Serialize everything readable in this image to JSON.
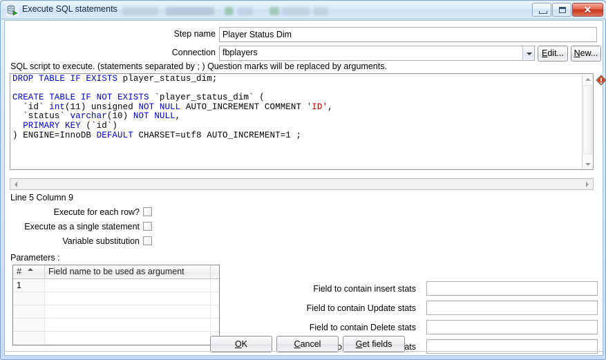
{
  "window": {
    "title": "Execute SQL statements",
    "icon": "database-execute-icon",
    "buttons": {
      "minimize": "minimize-icon",
      "maximize": "maximize-icon",
      "close": "✕"
    }
  },
  "form": {
    "step_name_label": "Step name",
    "step_name_value": "Player Status Dim",
    "connection_label": "Connection",
    "connection_value": "fbplayers",
    "edit_button": "Edit...",
    "edit_button_mnemonic": "E",
    "new_button": "New...",
    "new_button_mnemonic": "N"
  },
  "sql": {
    "hint": "SQL script to execute. (statements separated by ; ) Question marks will be replaced by arguments.",
    "lines": [
      [
        {
          "t": "DROP TABLE IF EXISTS ",
          "c": "kw"
        },
        {
          "t": "player_status_dim;",
          "c": ""
        }
      ],
      [
        {
          "t": "",
          "c": ""
        }
      ],
      [
        {
          "t": "CREATE TABLE IF NOT EXISTS ",
          "c": "kw"
        },
        {
          "t": "`player_status_dim` (",
          "c": ""
        }
      ],
      [
        {
          "t": "  `id` ",
          "c": ""
        },
        {
          "t": "int",
          "c": "kw"
        },
        {
          "t": "(11) unsigned ",
          "c": ""
        },
        {
          "t": "NOT NULL ",
          "c": "kw"
        },
        {
          "t": "AUTO_INCREMENT COMMENT ",
          "c": ""
        },
        {
          "t": "'ID'",
          "c": "str"
        },
        {
          "t": ",",
          "c": ""
        }
      ],
      [
        {
          "t": "  `status` ",
          "c": ""
        },
        {
          "t": "varchar",
          "c": "kw"
        },
        {
          "t": "(10) ",
          "c": ""
        },
        {
          "t": "NOT NULL",
          "c": "kw"
        },
        {
          "t": ",",
          "c": ""
        }
      ],
      [
        {
          "t": "  ",
          "c": ""
        },
        {
          "t": "PRIMARY KEY ",
          "c": "kw"
        },
        {
          "t": "(`id`)",
          "c": ""
        }
      ],
      [
        {
          "t": ") ENGINE=InnoDB ",
          "c": ""
        },
        {
          "t": "DEFAULT ",
          "c": "kw"
        },
        {
          "t": "CHARSET=utf8 AUTO_INCREMENT=1 ;",
          "c": ""
        }
      ]
    ],
    "caret_status": "Line 5 Column 9",
    "variable_indicator": "variable-diamond-icon"
  },
  "options": [
    {
      "label": "Execute for each row?",
      "checked": false,
      "name": "execute-for-each-row"
    },
    {
      "label": "Execute as a single statement",
      "checked": false,
      "name": "execute-as-single-statement"
    },
    {
      "label": "Variable substitution",
      "checked": false,
      "name": "variable-substitution"
    }
  ],
  "parameters": {
    "title": "Parameters :",
    "columns": [
      "#",
      "Field name to be used as argument",
      ""
    ],
    "sort_column": 0,
    "sort_direction": "asc",
    "rows": [
      [
        "1",
        "",
        ""
      ],
      [
        "",
        "",
        ""
      ],
      [
        "",
        "",
        ""
      ],
      [
        "",
        "",
        ""
      ],
      [
        "",
        "",
        ""
      ]
    ]
  },
  "stats_fields": [
    {
      "label": "Field to contain insert stats",
      "value": "",
      "name": "insert-stats-field"
    },
    {
      "label": "Field to contain Update stats",
      "value": "",
      "name": "update-stats-field"
    },
    {
      "label": "Field to contain Delete stats",
      "value": "",
      "name": "delete-stats-field"
    },
    {
      "label": "Field to contain Read stats",
      "value": "",
      "name": "read-stats-field"
    }
  ],
  "footer": {
    "ok": "OK",
    "ok_mnemonic": "O",
    "cancel": "Cancel",
    "cancel_mnemonic": "C",
    "get_fields": "Get fields",
    "get_fields_mnemonic": "G"
  },
  "colors": {
    "keyword": "#0000d0",
    "string": "#cc0000",
    "titlebar": "#d9eafb",
    "close_button": "#c8341c"
  }
}
